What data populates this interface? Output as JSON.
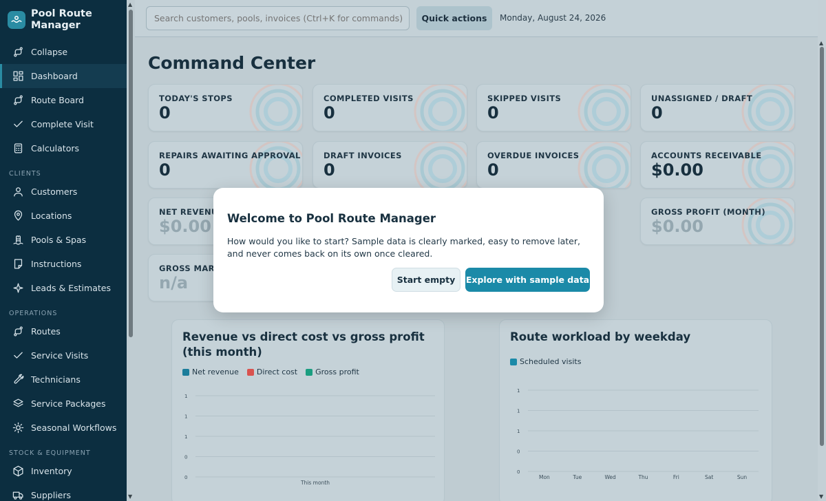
{
  "brand": {
    "title_line1": "Pool Route",
    "title_line2": "Manager"
  },
  "sidebar": {
    "items": [
      {
        "label": "Collapse",
        "icon": "route-icon"
      },
      {
        "label": "Dashboard",
        "icon": "dashboard-icon",
        "active": true
      },
      {
        "label": "Route Board",
        "icon": "route-icon"
      },
      {
        "label": "Complete Visit",
        "icon": "check-icon"
      },
      {
        "label": "Calculators",
        "icon": "calculator-icon"
      }
    ],
    "clients_section": "CLIENTS",
    "clients": [
      {
        "label": "Customers",
        "icon": "user-icon"
      },
      {
        "label": "Locations",
        "icon": "location-pin-icon"
      },
      {
        "label": "Pools & Spas",
        "icon": "pool-ladder-icon"
      },
      {
        "label": "Instructions",
        "icon": "note-icon"
      },
      {
        "label": "Leads & Estimates",
        "icon": "sparkle-icon"
      }
    ],
    "operations_section": "OPERATIONS",
    "operations": [
      {
        "label": "Routes",
        "icon": "route-icon"
      },
      {
        "label": "Service Visits",
        "icon": "check-icon"
      },
      {
        "label": "Technicians",
        "icon": "wrench-icon"
      },
      {
        "label": "Service Packages",
        "icon": "layers-icon"
      },
      {
        "label": "Seasonal Workflows",
        "icon": "sun-icon"
      }
    ],
    "stock_section": "STOCK & EQUIPMENT",
    "stock": [
      {
        "label": "Inventory",
        "icon": "box-icon"
      },
      {
        "label": "Suppliers",
        "icon": "truck-icon"
      }
    ]
  },
  "topbar": {
    "search_placeholder": "Search customers, pools, invoices (Ctrl+K for commands)",
    "quick_actions": "Quick actions",
    "date": "Monday, August 24, 2026"
  },
  "main": {
    "title": "Command Center",
    "cards": [
      {
        "label": "TODAY'S STOPS",
        "value": "0"
      },
      {
        "label": "COMPLETED VISITS",
        "value": "0"
      },
      {
        "label": "SKIPPED VISITS",
        "value": "0"
      },
      {
        "label": "UNASSIGNED / DRAFT",
        "value": "0"
      },
      {
        "label": "REPAIRS AWAITING APPROVAL",
        "value": "0"
      },
      {
        "label": "DRAFT INVOICES",
        "value": "0"
      },
      {
        "label": "OVERDUE INVOICES",
        "value": "0"
      },
      {
        "label": "ACCOUNTS RECEIVABLE",
        "value": "$0.00"
      },
      {
        "label": "NET REVENUE",
        "value": "$0.00"
      },
      {
        "label": "GROSS PROFIT (MONTH)",
        "value": "$0.00"
      },
      {
        "label": "GROSS MARGIN",
        "value": "n/a"
      }
    ]
  },
  "chart_data": [
    {
      "type": "bar",
      "title": "Revenue vs direct cost vs gross profit (this month)",
      "categories": [
        "This month"
      ],
      "series": [
        {
          "name": "Net revenue",
          "values": [
            0
          ],
          "color": "#1b7d9b"
        },
        {
          "name": "Direct cost",
          "values": [
            0
          ],
          "color": "#d9534f"
        },
        {
          "name": "Gross profit",
          "values": [
            0
          ],
          "color": "#1a9e80"
        }
      ],
      "yticks": [
        "1",
        "1",
        "1",
        "0",
        "0"
      ]
    },
    {
      "type": "bar",
      "title": "Route workload by weekday",
      "categories": [
        "Mon",
        "Tue",
        "Wed",
        "Thu",
        "Fri",
        "Sat",
        "Sun"
      ],
      "series": [
        {
          "name": "Scheduled visits",
          "values": [
            0,
            0,
            0,
            0,
            0,
            0,
            0
          ],
          "color": "#1b8aa8"
        }
      ],
      "yticks": [
        "1",
        "1",
        "1",
        "0",
        "0"
      ]
    }
  ],
  "modal": {
    "title": "Welcome to Pool Route Manager",
    "body": "How would you like to start? Sample data is clearly marked, easy to remove later, and never comes back on its own once cleared.",
    "start_empty": "Start empty",
    "explore": "Explore with sample data"
  }
}
